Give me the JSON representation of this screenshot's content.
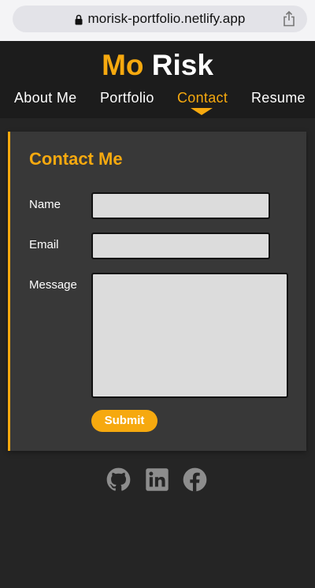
{
  "browser": {
    "url": "morisk-portfolio.netlify.app"
  },
  "header": {
    "logo_first": "Mo",
    "logo_last": "Risk",
    "nav": [
      {
        "label": "About Me",
        "active": false
      },
      {
        "label": "Portfolio",
        "active": false
      },
      {
        "label": "Contact",
        "active": true
      },
      {
        "label": "Resume",
        "active": false
      }
    ]
  },
  "contact": {
    "title": "Contact Me",
    "name_label": "Name",
    "email_label": "Email",
    "message_label": "Message",
    "name_value": "",
    "email_value": "",
    "message_value": "",
    "submit_label": "Submit"
  },
  "socials": [
    {
      "icon": "github-icon"
    },
    {
      "icon": "linkedin-icon"
    },
    {
      "icon": "facebook-icon"
    }
  ],
  "colors": {
    "accent": "#f6a90f",
    "background": "#252525",
    "header": "#1c1c1c",
    "card": "#383838",
    "input": "#dcdcdc"
  }
}
